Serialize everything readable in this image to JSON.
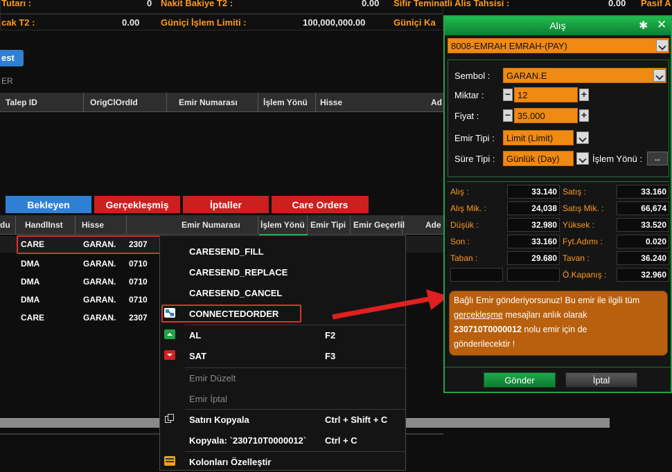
{
  "summary": {
    "row1_left_label": "Tutarı :",
    "row1_left_value": "0",
    "row1_mid_label": "Nakit Bakiye T2 :",
    "row1_mid_value": "0.00",
    "row1_right_label": "Sifir Teminatli Alis Tahsisi :",
    "row1_right_value": "0.00",
    "row1_far_label": "Pasif A",
    "row2_left_label": "cak T2 :",
    "row2_left_value": "0.00",
    "row2_mid_label": "Güniçi İşlem Limiti :",
    "row2_mid_value": "100,000,000.00",
    "row2_right_label": "Güniçi Ka"
  },
  "upper": {
    "button_label": "est",
    "section_label": "ER",
    "columns": [
      "Talep ID",
      "OrigClOrdId",
      "Emir Numarası",
      "İşlem Yönü",
      "Hisse",
      "Ad"
    ]
  },
  "tabs": [
    {
      "label": "Bekleyen",
      "color": "#2f7fd4"
    },
    {
      "label": "Gerçekleşmiş",
      "color": "#cc1f1f"
    },
    {
      "label": "İptaller",
      "color": "#cc1f1f"
    },
    {
      "label": "Care Orders",
      "color": "#cc1f1f"
    }
  ],
  "grid": {
    "columns": [
      "du",
      "HandlInst",
      "Hisse",
      "Emir Numarası",
      "İşlem Yönü",
      "Emir Tipi",
      "Emir Geçerlil",
      "Ade"
    ],
    "rows": [
      {
        "handl": "CARE",
        "hisse": "GARAN.",
        "emir": "2307"
      },
      {
        "handl": "DMA",
        "hisse": "GARAN.",
        "emir": "0710"
      },
      {
        "handl": "DMA",
        "hisse": "GARAN.",
        "emir": "0710"
      },
      {
        "handl": "DMA",
        "hisse": "GARAN.",
        "emir": "0710"
      },
      {
        "handl": "CARE",
        "hisse": "GARAN.",
        "emir": "2307"
      }
    ]
  },
  "context_menu": {
    "items": [
      {
        "label": "CARESEND_FILL",
        "shortcut": ""
      },
      {
        "label": "CARESEND_REPLACE",
        "shortcut": ""
      },
      {
        "label": "CARESEND_CANCEL",
        "shortcut": ""
      },
      {
        "label": "CONNECTEDORDER",
        "shortcut": "",
        "icon": "connected-order-icon"
      },
      {
        "label": "AL",
        "shortcut": "F2",
        "icon": "buy-icon",
        "icon_color": "#22a34a"
      },
      {
        "label": "SAT",
        "shortcut": "F3",
        "icon": "sell-icon",
        "icon_color": "#d42020"
      },
      {
        "label": "Emir Düzelt",
        "shortcut": "",
        "disabled": true
      },
      {
        "label": "Emir İptal",
        "shortcut": "",
        "disabled": true
      },
      {
        "label": "Satırı Kopyala",
        "shortcut": "Ctrl + Shift + C",
        "icon": "copy-icon"
      },
      {
        "label": "Kopyala: `230710T0000012`",
        "shortcut": "Ctrl + C"
      },
      {
        "label": "Kolonları Özelleştir",
        "shortcut": "",
        "icon": "columns-icon"
      }
    ]
  },
  "dialog": {
    "title": "Alış",
    "account": "8008-EMRAH EMRAH-(PAY)",
    "symbol_label": "Sembol :",
    "symbol_value": "GARAN.E",
    "qty_label": "Miktar :",
    "qty_value": "12",
    "price_label": "Fiyat :",
    "price_value": "35.000",
    "order_type_label": "Emir Tipi :",
    "order_type_value": "Limit (Limit)",
    "duration_label": "Süre Tipi :",
    "duration_value": "Günlük (Day)",
    "direction_label": "İşlem Yönü :",
    "quotes": [
      {
        "l1": "Alış :",
        "v1": "33.140",
        "l2": "Satış :",
        "v2": "33.160"
      },
      {
        "l1": "Alış Mik. :",
        "v1": "24,038",
        "l2": "Satış Mik. :",
        "v2": "66,674"
      },
      {
        "l1": "Düşük :",
        "v1": "32.980",
        "l2": "Yüksek :",
        "v2": "33.520"
      },
      {
        "l1": "Son :",
        "v1": "33.160",
        "l2": "Fyt.Adımı :",
        "v2": "0.020"
      },
      {
        "l1": "Taban :",
        "v1": "29.680",
        "l2": "Tavan :",
        "v2": "36.240"
      },
      {
        "l1": "",
        "v1": "",
        "l2": "Ö.Kapanış :",
        "v2": "32.960"
      }
    ],
    "info_line1": "Bağlı Emir gönderiyorsunuz! Bu emir ile ilgili tüm",
    "info_link": "gerçekleşme",
    "info_line2_rest": " mesajları anlık olarak",
    "info_order": "230710T0000012",
    "info_line3_rest": " nolu emir için de",
    "info_line4": "gönderilecektir !",
    "send_label": "Gönder",
    "cancel_label": "İptal"
  },
  "colors": {
    "accent_orange": "#ff9a1f",
    "dialog_green": "#22a34a",
    "highlight_red": "#e03030"
  }
}
